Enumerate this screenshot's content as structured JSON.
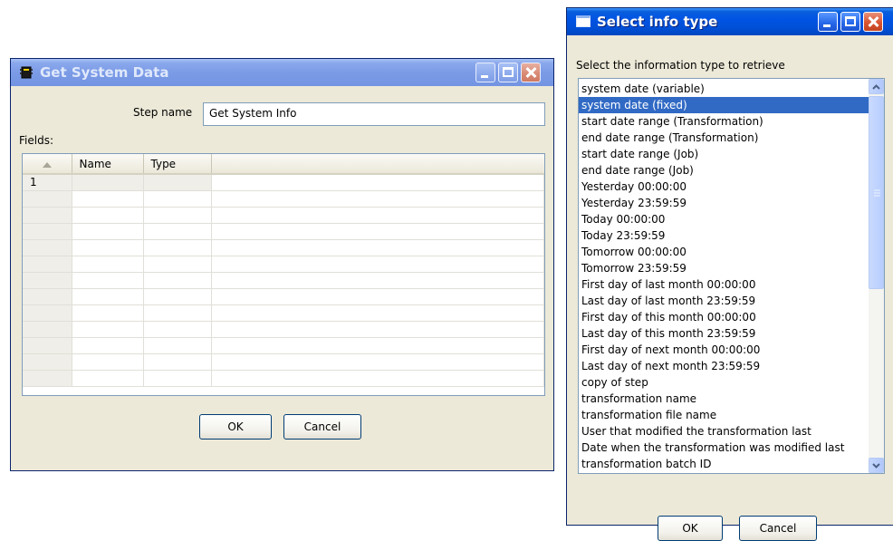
{
  "get_system_data": {
    "title": "Get System Data",
    "step_name_label": "Step name",
    "step_name_value": "Get System Info",
    "fields_label": "Fields:",
    "table": {
      "sort_icon": "triangle-up-icon",
      "columns": [
        "Name",
        "Type"
      ],
      "rows": [
        {
          "num": "1",
          "name": "",
          "type": ""
        }
      ]
    },
    "ok_label": "OK",
    "cancel_label": "Cancel"
  },
  "select_info_type": {
    "title": "Select info type",
    "prompt": "Select the information type to retrieve",
    "selected_index": 1,
    "items": [
      "system date (variable)",
      "system date (fixed)",
      "start date range (Transformation)",
      "end date range (Transformation)",
      "start date range (Job)",
      "end date range (Job)",
      "Yesterday 00:00:00",
      "Yesterday 23:59:59",
      "Today 00:00:00",
      "Today 23:59:59",
      "Tomorrow 00:00:00",
      "Tomorrow 23:59:59",
      "First day of last month 00:00:00",
      "Last day of last month 23:59:59",
      "First day of this month 00:00:00",
      "Last day of this month 23:59:59",
      "First day of next month 00:00:00",
      "Last day of next month 23:59:59",
      "copy of step",
      "transformation name",
      "transformation file name",
      "User that modified the transformation last",
      "Date when the transformation was modified last",
      "transformation batch ID"
    ],
    "ok_label": "OK",
    "cancel_label": "Cancel"
  },
  "colors": {
    "title_active": "#0054e3",
    "title_inactive": "#7b9be6",
    "selection": "#316ac5",
    "dialog_bg": "#ece9d8"
  }
}
